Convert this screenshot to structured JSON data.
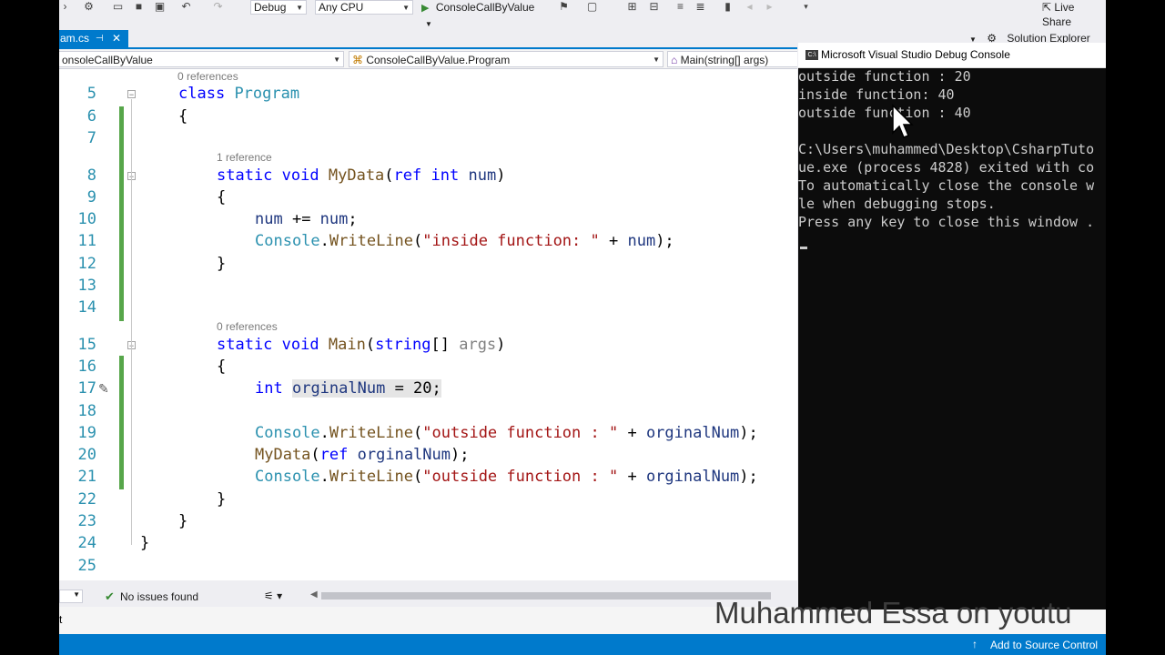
{
  "toolbar": {
    "config": "Debug",
    "platform": "Any CPU",
    "start_label": "ConsoleCallByValue",
    "live_share": "Live Share"
  },
  "tab": {
    "label": "am.cs",
    "pin": "⊣",
    "close": "✕"
  },
  "solution_explorer": "Solution Explorer",
  "nav": {
    "project": "onsoleCallByValue",
    "class": "ConsoleCallByValue.Program",
    "member": "Main(string[] args)"
  },
  "codelens": {
    "program": "0 references",
    "mydata": "1 reference",
    "main": "0 references"
  },
  "line_numbers": [
    "5",
    "6",
    "7",
    "8",
    "9",
    "10",
    "11",
    "12",
    "13",
    "14",
    "15",
    "16",
    "17",
    "18",
    "19",
    "20",
    "21",
    "22",
    "23",
    "24",
    "25"
  ],
  "status": {
    "issues": "No issues found",
    "output_tab": "t"
  },
  "source_control": "Add to Source Control",
  "watermark": "Muhammed Essa on youtu",
  "console": {
    "title": "Microsoft Visual Studio Debug Console",
    "icon": "C:\\",
    "lines": [
      "outside function : 20",
      "inside function: 40",
      "outside function : 40",
      "",
      "C:\\Users\\muhammed\\Desktop\\CsharpTuto",
      "ue.exe (process 4828) exited with co",
      "To automatically close the console w",
      "le when debugging stops.",
      "Press any key to close this window ."
    ]
  },
  "colors": {
    "accent": "#007acc",
    "line_number": "#2b91af",
    "keyword": "#0000ff",
    "string": "#a31515",
    "change_bar": "#57a64a"
  }
}
